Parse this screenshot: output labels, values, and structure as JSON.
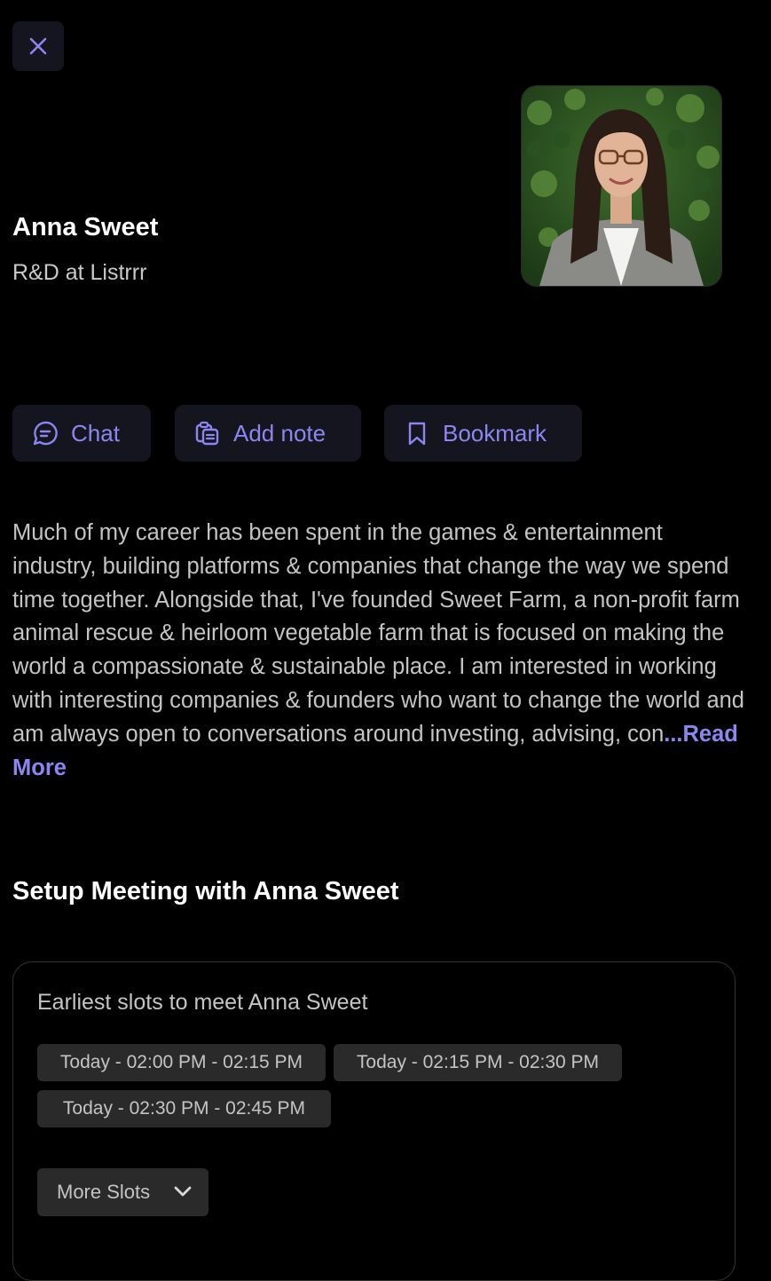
{
  "header": {
    "close_icon": "close-icon"
  },
  "profile": {
    "name": "Anna Sweet",
    "role": "R&D at Listrrr",
    "photo": "profile-photo"
  },
  "actions": [
    {
      "label": "Chat",
      "icon": "chat-bubble-icon"
    },
    {
      "label": "Add note",
      "icon": "add-note-icon"
    },
    {
      "label": "Bookmark",
      "icon": "bookmark-icon"
    }
  ],
  "bio": {
    "text": "Much of my career has been spent in the games & entertainment industry, building platforms & companies that change the way we spend time together. Alongside that, I've founded Sweet Farm, a non-profit farm animal rescue & heirloom vegetable farm that is focused on making the world a compassionate & sustainable place. I am interested in working with interesting companies & founders who want to change the world and am always open to conversations around investing, advising, con",
    "read_more": "...Read More"
  },
  "meeting": {
    "title": "Setup Meeting with Anna Sweet",
    "slots_heading": "Earliest slots to meet Anna Sweet",
    "slots": [
      "Today - 02:00 PM - 02:15 PM",
      "Today - 02:15 PM - 02:30 PM",
      "Today - 02:30 PM - 02:45 PM"
    ],
    "more_slots_label": "More Slots",
    "more_slots_icon": "chevron-down-icon"
  },
  "colors": {
    "background": "#000000",
    "accent": "#8c86f0",
    "button_bg": "#15151f",
    "chip_bg": "#2a2a2a",
    "muted_text": "#c4c4c4"
  }
}
